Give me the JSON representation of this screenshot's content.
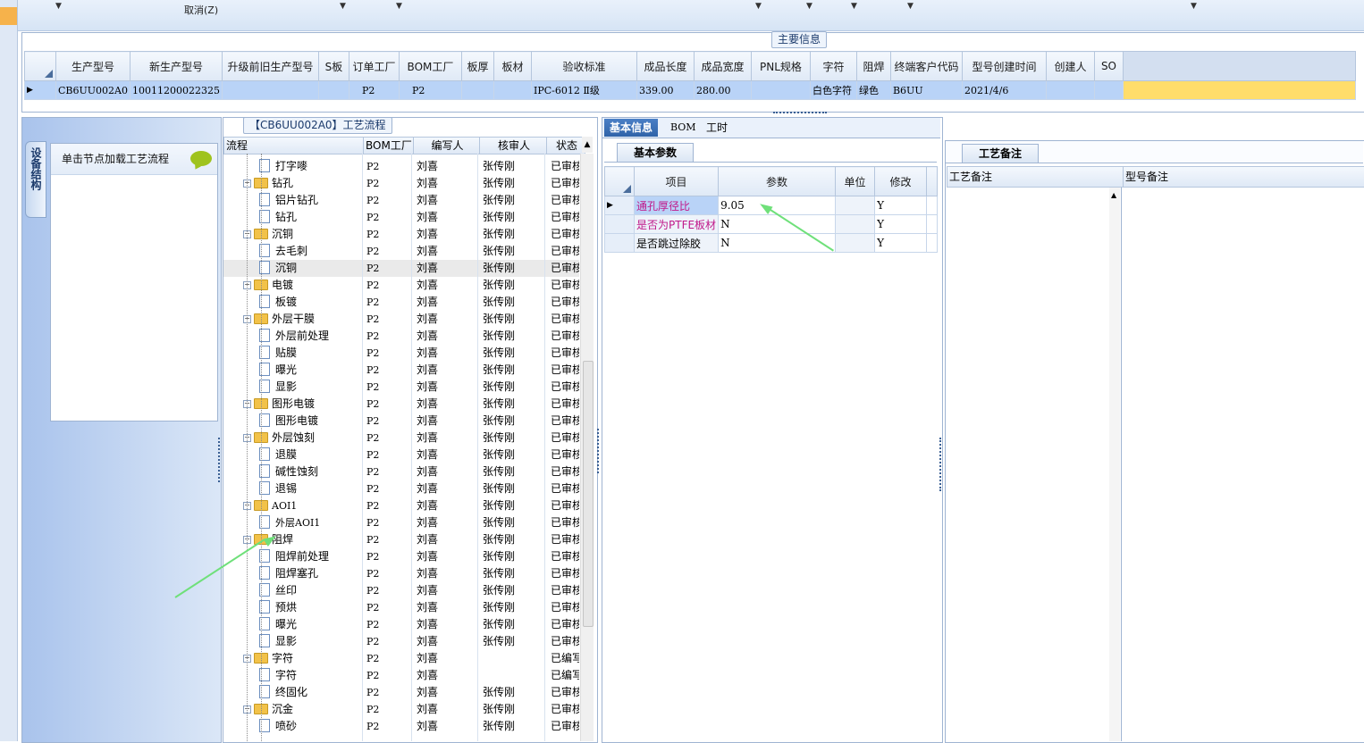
{
  "toolbar": {
    "cancel_label": "取消(Z)"
  },
  "main_info": {
    "title": "主要信息",
    "headers": [
      "生产型号",
      "新生产型号",
      "升级前旧生产型号",
      "S板",
      "订单工厂",
      "BOM工厂",
      "板厚",
      "板材",
      "验收标准",
      "成品长度",
      "成品宽度",
      "PNL规格",
      "字符",
      "阻焊",
      "终端客户代码",
      "型号创建时间",
      "创建人",
      "SO"
    ],
    "row": [
      "CB6UU002A0",
      "10011200022325",
      "",
      "",
      "P2",
      "P2",
      "",
      "",
      "IPC-6012 Ⅱ级",
      "339.00",
      "280.00",
      "",
      "白色字符",
      "绿色",
      "B6UU",
      "2021/4/6",
      "",
      ""
    ]
  },
  "left_panel": {
    "vertical_tab": "设备结构",
    "load_hint": "单击节点加载工艺流程"
  },
  "process": {
    "title": "【CB6UU002A0】工艺流程",
    "headers": [
      "流程",
      "BOM工厂",
      "编写人",
      "核审人",
      "状态"
    ],
    "rows": [
      {
        "name": "打字嘜",
        "type": "doc",
        "bom": "P2",
        "writer": "刘喜",
        "reviewer": "张传刚",
        "status": "已审核"
      },
      {
        "name": "钻孔",
        "type": "folder",
        "bom": "P2",
        "writer": "刘喜",
        "reviewer": "张传刚",
        "status": "已审核"
      },
      {
        "name": "铝片钻孔",
        "type": "doc",
        "bom": "P2",
        "writer": "刘喜",
        "reviewer": "张传刚",
        "status": "已审核"
      },
      {
        "name": "钻孔",
        "type": "doc",
        "bom": "P2",
        "writer": "刘喜",
        "reviewer": "张传刚",
        "status": "已审核"
      },
      {
        "name": "沉铜",
        "type": "folder",
        "bom": "P2",
        "writer": "刘喜",
        "reviewer": "张传刚",
        "status": "已审核"
      },
      {
        "name": "去毛刺",
        "type": "doc",
        "bom": "P2",
        "writer": "刘喜",
        "reviewer": "张传刚",
        "status": "已审核"
      },
      {
        "name": "沉铜",
        "type": "doc",
        "bom": "P2",
        "writer": "刘喜",
        "reviewer": "张传刚",
        "status": "已审核",
        "selected": true
      },
      {
        "name": "电镀",
        "type": "folder",
        "bom": "P2",
        "writer": "刘喜",
        "reviewer": "张传刚",
        "status": "已审核"
      },
      {
        "name": "板镀",
        "type": "doc",
        "bom": "P2",
        "writer": "刘喜",
        "reviewer": "张传刚",
        "status": "已审核"
      },
      {
        "name": "外层干膜",
        "type": "folder",
        "bom": "P2",
        "writer": "刘喜",
        "reviewer": "张传刚",
        "status": "已审核"
      },
      {
        "name": "外层前处理",
        "type": "doc",
        "bom": "P2",
        "writer": "刘喜",
        "reviewer": "张传刚",
        "status": "已审核"
      },
      {
        "name": "贴膜",
        "type": "doc",
        "bom": "P2",
        "writer": "刘喜",
        "reviewer": "张传刚",
        "status": "已审核"
      },
      {
        "name": "曝光",
        "type": "doc",
        "bom": "P2",
        "writer": "刘喜",
        "reviewer": "张传刚",
        "status": "已审核"
      },
      {
        "name": "显影",
        "type": "doc",
        "bom": "P2",
        "writer": "刘喜",
        "reviewer": "张传刚",
        "status": "已审核"
      },
      {
        "name": "图形电镀",
        "type": "folder",
        "bom": "P2",
        "writer": "刘喜",
        "reviewer": "张传刚",
        "status": "已审核"
      },
      {
        "name": "图形电镀",
        "type": "doc",
        "bom": "P2",
        "writer": "刘喜",
        "reviewer": "张传刚",
        "status": "已审核"
      },
      {
        "name": "外层蚀刻",
        "type": "folder",
        "bom": "P2",
        "writer": "刘喜",
        "reviewer": "张传刚",
        "status": "已审核"
      },
      {
        "name": "退膜",
        "type": "doc",
        "bom": "P2",
        "writer": "刘喜",
        "reviewer": "张传刚",
        "status": "已审核"
      },
      {
        "name": "碱性蚀刻",
        "type": "doc",
        "bom": "P2",
        "writer": "刘喜",
        "reviewer": "张传刚",
        "status": "已审核"
      },
      {
        "name": "退锡",
        "type": "doc",
        "bom": "P2",
        "writer": "刘喜",
        "reviewer": "张传刚",
        "status": "已审核"
      },
      {
        "name": "AOI1",
        "type": "folder",
        "bom": "P2",
        "writer": "刘喜",
        "reviewer": "张传刚",
        "status": "已审核"
      },
      {
        "name": "外层AOI1",
        "type": "doc",
        "bom": "P2",
        "writer": "刘喜",
        "reviewer": "张传刚",
        "status": "已审核"
      },
      {
        "name": "阻焊",
        "type": "folder",
        "bom": "P2",
        "writer": "刘喜",
        "reviewer": "张传刚",
        "status": "已审核"
      },
      {
        "name": "阻焊前处理",
        "type": "doc",
        "bom": "P2",
        "writer": "刘喜",
        "reviewer": "张传刚",
        "status": "已审核"
      },
      {
        "name": "阻焊塞孔",
        "type": "doc",
        "bom": "P2",
        "writer": "刘喜",
        "reviewer": "张传刚",
        "status": "已审核"
      },
      {
        "name": "丝印",
        "type": "doc",
        "bom": "P2",
        "writer": "刘喜",
        "reviewer": "张传刚",
        "status": "已审核"
      },
      {
        "name": "预烘",
        "type": "doc",
        "bom": "P2",
        "writer": "刘喜",
        "reviewer": "张传刚",
        "status": "已审核"
      },
      {
        "name": "曝光",
        "type": "doc",
        "bom": "P2",
        "writer": "刘喜",
        "reviewer": "张传刚",
        "status": "已审核"
      },
      {
        "name": "显影",
        "type": "doc",
        "bom": "P2",
        "writer": "刘喜",
        "reviewer": "张传刚",
        "status": "已审核"
      },
      {
        "name": "字符",
        "type": "folder",
        "bom": "P2",
        "writer": "刘喜",
        "reviewer": "",
        "status": "已编写"
      },
      {
        "name": "字符",
        "type": "doc",
        "bom": "P2",
        "writer": "刘喜",
        "reviewer": "",
        "status": "已编写"
      },
      {
        "name": "终固化",
        "type": "doc",
        "bom": "P2",
        "writer": "刘喜",
        "reviewer": "张传刚",
        "status": "已审核"
      },
      {
        "name": "沉金",
        "type": "folder",
        "bom": "P2",
        "writer": "刘喜",
        "reviewer": "张传刚",
        "status": "已审核"
      },
      {
        "name": "喷砂",
        "type": "doc",
        "bom": "P2",
        "writer": "刘喜",
        "reviewer": "张传刚",
        "status": "已审核"
      }
    ]
  },
  "basic": {
    "tabs": [
      "基本信息",
      "BOM",
      "工时"
    ],
    "subtab": "基本参数",
    "headers": [
      "项目",
      "参数",
      "单位",
      "修改"
    ],
    "rows": [
      {
        "item": "通孔厚径比",
        "param": "9.05",
        "unit": "",
        "edit": "Y",
        "highlight": true
      },
      {
        "item": "是否为PTFE板材",
        "param": "N",
        "unit": "",
        "edit": "Y",
        "highlight": true
      },
      {
        "item": "是否跳过除胶",
        "param": "N",
        "unit": "",
        "edit": "Y",
        "highlight": false
      }
    ]
  },
  "notes": {
    "tab": "工艺备注",
    "col1": "工艺备注",
    "col2": "型号备注"
  },
  "colors": {
    "highlight_text": "#c0188a",
    "selected_row": "#b9d3f7",
    "arrow": "#6fe07a"
  }
}
